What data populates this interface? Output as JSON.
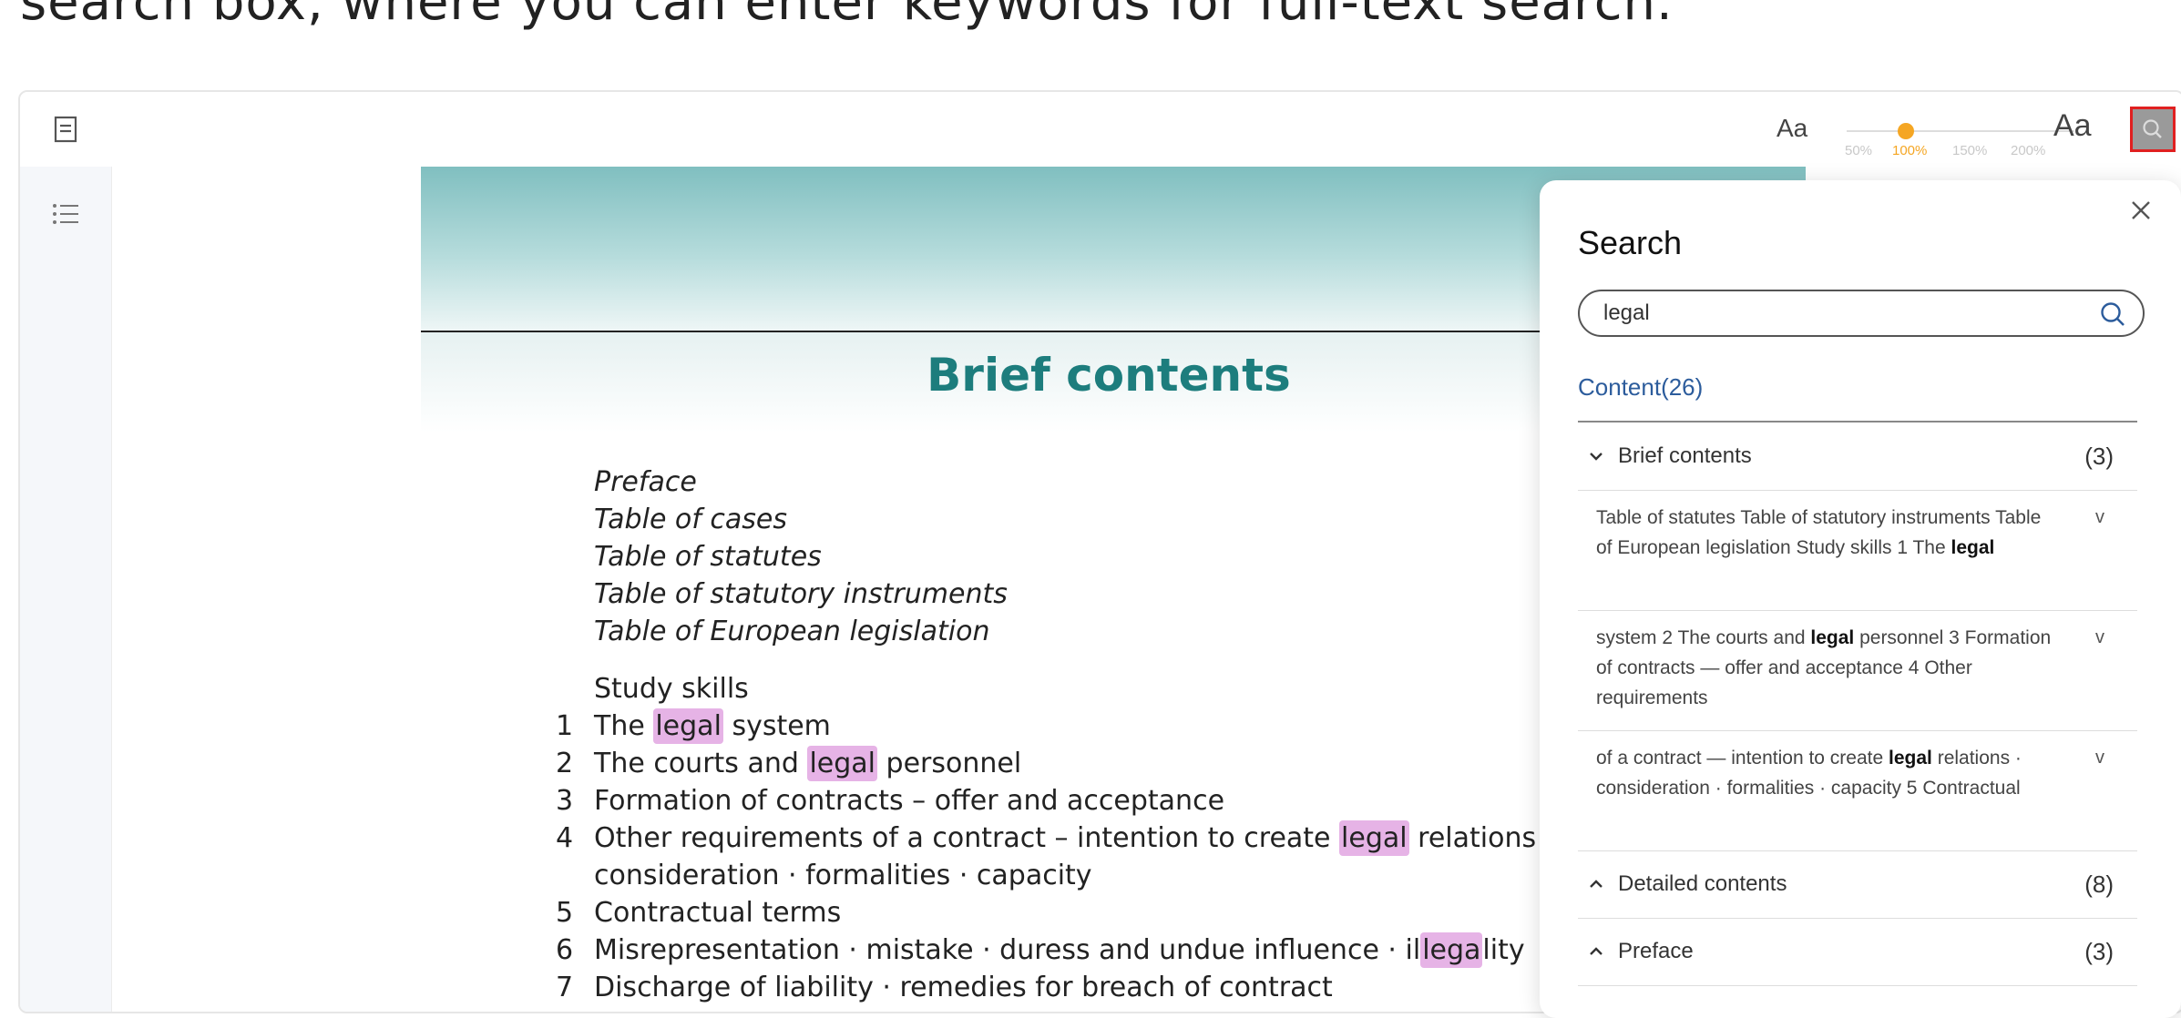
{
  "caption": "search box, where you can enter keywords for full-text search.",
  "toolbar": {
    "font_small_label": "Aa",
    "font_large_label": "Aa",
    "zoom_options": [
      "50%",
      "100%",
      "150%",
      "200%"
    ],
    "zoom_selected": "100%",
    "accent_color": "#f5a623"
  },
  "book": {
    "title": "Brief contents",
    "front_matter": [
      "Preface",
      "Table of cases",
      "Table of statutes",
      "Table of statutory instruments",
      "Table of European legislation"
    ],
    "study_skills": "Study skills",
    "chapters": [
      {
        "num": "1",
        "before": "The ",
        "hit": "legal",
        "after": " system"
      },
      {
        "num": "2",
        "before": "The courts and ",
        "hit": "legal",
        "after": " personnel"
      },
      {
        "num": "3",
        "before": "Formation of contracts – offer and acceptance",
        "hit": "",
        "after": ""
      },
      {
        "num": "4",
        "before": "Other requirements of a contract – intention to create ",
        "hit": "legal",
        "after": " relations ·"
      },
      {
        "num": "",
        "before": "consideration · formalities · capacity",
        "hit": "",
        "after": ""
      },
      {
        "num": "5",
        "before": "Contractual terms",
        "hit": "",
        "after": ""
      },
      {
        "num": "6",
        "before": "Misrepresentation · mistake · duress and undue influence · il",
        "hit": "lega",
        "after": "lity"
      },
      {
        "num": "7",
        "before": "Discharge of liability · remedies for breach of contract",
        "hit": "",
        "after": ""
      }
    ]
  },
  "search": {
    "title": "Search",
    "query": "legal",
    "content_count": "Content(26)",
    "groups": [
      {
        "name": "Brief contents",
        "count": "(3)",
        "expanded": true
      },
      {
        "name": "Detailed contents",
        "count": "(8)",
        "expanded": false
      },
      {
        "name": "Preface",
        "count": "(3)",
        "expanded": false
      }
    ],
    "results": [
      {
        "before": "Table of statutes Table of statutory instruments Table of European legislation Study skills 1 The ",
        "hit": "legal",
        "after": "",
        "more": "v"
      },
      {
        "before": "system 2 The courts and ",
        "hit": "legal",
        "after": " personnel 3 Formation of contracts — offer and acceptance 4 Other requirements",
        "more": "v"
      },
      {
        "before": "of a contract — intention to create ",
        "hit": "legal",
        "after": " relations · consideration · formalities · capacity 5 Contractual",
        "more": "v"
      }
    ]
  }
}
